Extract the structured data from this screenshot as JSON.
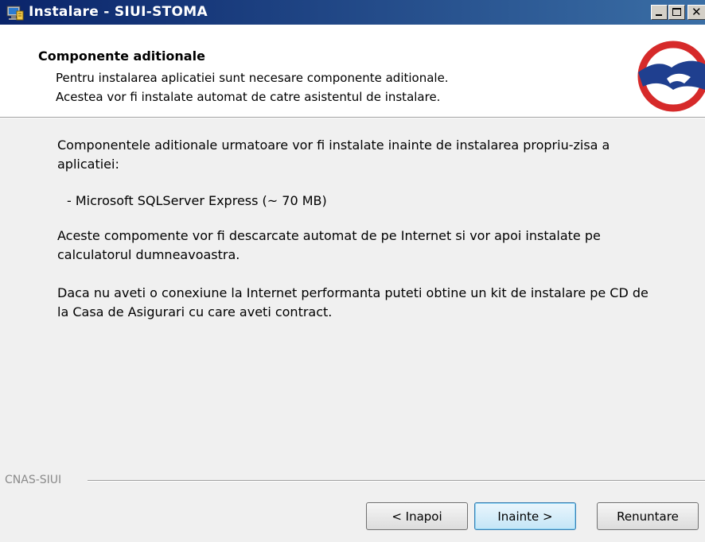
{
  "window": {
    "title": "Instalare - SIUI-STOMA",
    "minimize_glyph": "",
    "maximize_glyph": "",
    "close_glyph": "✕"
  },
  "header": {
    "title": "Componente aditionale",
    "subtitle_line1": "Pentru instalarea aplicatiei sunt necesare componente aditionale.",
    "subtitle_line2": "Acestea vor fi instalate automat de catre asistentul de instalare."
  },
  "content": {
    "paragraph1": "Componentele aditionale urmatoare vor fi instalate inainte de instalarea propriu-zisa a aplicatiei:",
    "component_item": "- Microsoft SQLServer Express (~ 70 MB)",
    "paragraph2": "Aceste compomente vor fi descarcate automat de pe Internet si vor apoi instalate pe calculatorul dumneavoastra.",
    "paragraph3": "Daca nu aveti o conexiune la Internet performanta puteti obtine un kit de instalare pe CD de la Casa de Asigurari cu care aveti contract."
  },
  "footer": {
    "brand_label": "CNAS-SIUI",
    "back_label": "< Inapoi",
    "next_label": "Inainte >",
    "cancel_label": "Renuntare"
  },
  "colors": {
    "titlebar_start": "#0a246a",
    "titlebar_end": "#3a6ea5",
    "logo_red": "#d62a2a",
    "logo_blue": "#1f3f8f"
  },
  "icons": {
    "app_icon": "installer-computer-icon",
    "logo": "cnas-logo"
  }
}
